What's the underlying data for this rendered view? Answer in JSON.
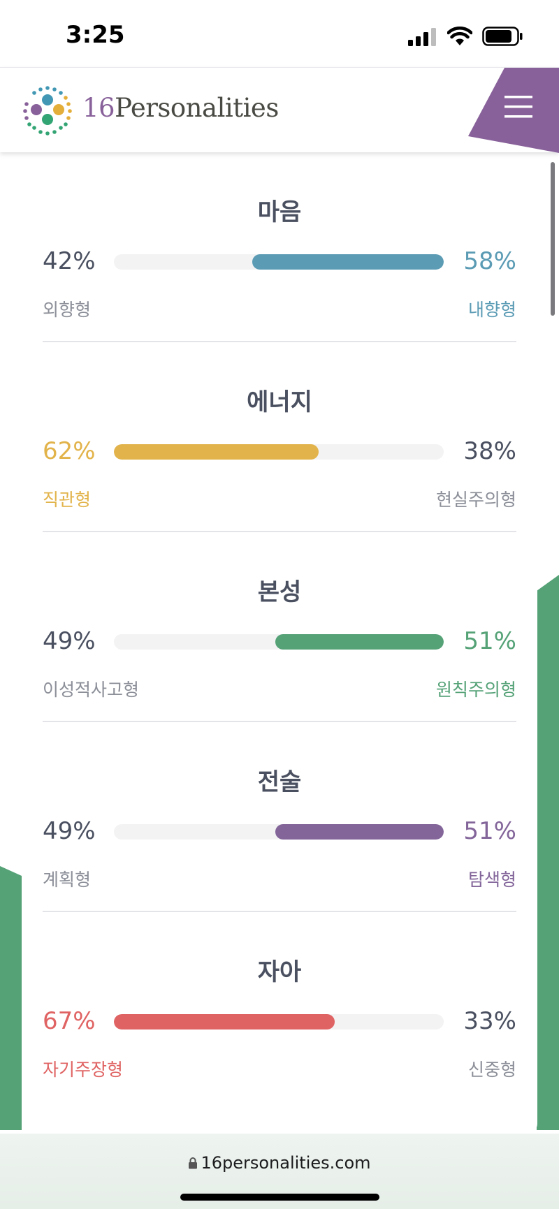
{
  "status_bar": {
    "time": "3:25"
  },
  "header": {
    "brand_number": "16",
    "brand_name": "Personalities"
  },
  "traits": [
    {
      "title": "마음",
      "left_percent": "42%",
      "right_percent": "58%",
      "left_label": "외향형",
      "right_label": "내향형",
      "dominant": "right",
      "fill_fraction": 0.58,
      "color": "#5b9bb4"
    },
    {
      "title": "에너지",
      "left_percent": "62%",
      "right_percent": "38%",
      "left_label": "직관형",
      "right_label": "현실주의형",
      "dominant": "left",
      "fill_fraction": 0.62,
      "color": "#e2b34a"
    },
    {
      "title": "본성",
      "left_percent": "49%",
      "right_percent": "51%",
      "left_label": "이성적사고형",
      "right_label": "원칙주의형",
      "dominant": "right",
      "fill_fraction": 0.51,
      "color": "#55a277"
    },
    {
      "title": "전술",
      "left_percent": "49%",
      "right_percent": "51%",
      "left_label": "계획형",
      "right_label": "탐색형",
      "dominant": "right",
      "fill_fraction": 0.51,
      "color": "#83659a"
    },
    {
      "title": "자아",
      "left_percent": "67%",
      "right_percent": "33%",
      "left_label": "자기주장형",
      "right_label": "신중형",
      "dominant": "left",
      "fill_fraction": 0.67,
      "color": "#e06363"
    }
  ],
  "neutral_text_color": "#4a5060",
  "neutral_label_color": "#8c8f98",
  "url_bar": {
    "url": "16personalities.com"
  }
}
